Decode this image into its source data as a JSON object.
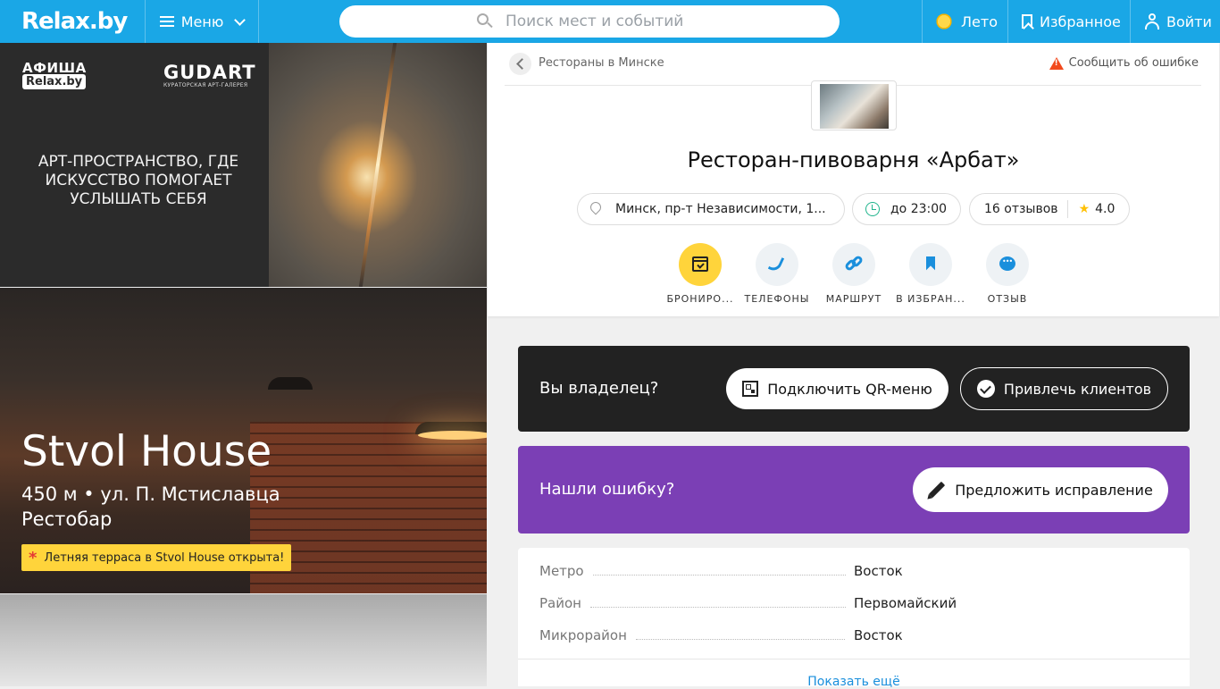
{
  "header": {
    "logo": "Relax.by",
    "menu_label": "Меню",
    "search_placeholder": "Поиск мест и событий",
    "season_label": "Лето",
    "favorites_label": "Избранное",
    "login_label": "Войти"
  },
  "ads": {
    "ad1": {
      "brand1": "АФИША",
      "brand1_badge": "Relax.by",
      "brand2": "GUDART",
      "brand2_sub": "КУРАТОРСКАЯ АРТ-ГАЛЕРЕЯ",
      "text": "АРТ-ПРОСТРАНСТВО, ГДЕ ИСКУССТВО ПОМОГАЕТ УСЛЫШАТЬ СЕБЯ"
    },
    "ad2": {
      "title": "Stvol House",
      "subtitle": "450 м • ул. П. Мстиславца",
      "category": "Рестобар",
      "badge": "Летняя терраса в Stvol House открыта!"
    }
  },
  "place": {
    "breadcrumb": "Рестораны в Минске",
    "report_label": "Сообщить об ошибке",
    "title": "Ресторан-пивоварня «Арбат»",
    "address": "Минск, пр-т Независимости, 1...",
    "hours": "до 23:00",
    "reviews": "16 отзывов",
    "rating": "4.0",
    "actions": [
      {
        "label": "БРОНИРО..."
      },
      {
        "label": "ТЕЛЕФОНЫ"
      },
      {
        "label": "МАРШРУТ"
      },
      {
        "label": "В ИЗБРАН..."
      },
      {
        "label": "ОТЗЫВ"
      }
    ]
  },
  "owner": {
    "question": "Вы владелец?",
    "qr_button": "Подключить QR-меню",
    "clients_button": "Привлечь клиентов"
  },
  "mistake": {
    "question": "Нашли ошибку?",
    "suggest_button": "Предложить исправление"
  },
  "info": {
    "rows": [
      {
        "key": "Метро",
        "value": "Восток"
      },
      {
        "key": "Район",
        "value": "Первомайский"
      },
      {
        "key": "Микрорайон",
        "value": "Восток"
      }
    ],
    "more_label": "Показать ещё"
  },
  "colors": {
    "header": "#1aa7e6",
    "accent_yellow": "#ffd43b",
    "purple": "#7b3fb5",
    "dark": "#222222",
    "link": "#1a8fdc"
  }
}
